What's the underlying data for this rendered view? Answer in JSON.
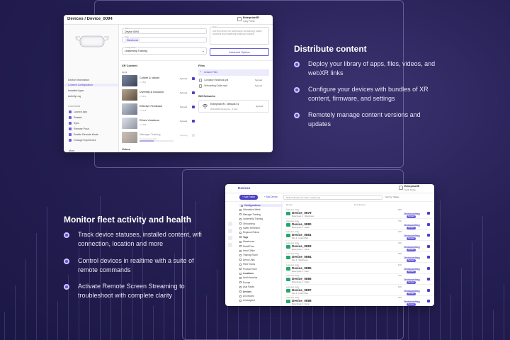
{
  "right_section": {
    "heading": "Distribute content",
    "bullets": [
      "Deploy your library of apps, files, videos, and webXR links",
      "Configure your devices with bundles of XR content, firmware, and settings",
      "Remotely manage content versions and updates"
    ]
  },
  "left_section": {
    "heading": "Monitor fleet activity and health",
    "bullets": [
      "Track device statuses, installed content, wifi connection, location and more",
      "Control devices in realtime with a suite of remote commands",
      "Activate Remote Screen Streaming to troubleshoot with complete clarity"
    ]
  },
  "device_panel": {
    "breadcrumb": "Devices / Device_0094",
    "org_name": "EnterpriseXR",
    "org_user": "Carly Fisher",
    "sidebar": [
      "Device Information",
      "Content Configuration",
      "Installed Apps",
      "Activity Log"
    ],
    "commands_title": "Commands",
    "commands": [
      "Launch App",
      "Restart",
      "Sync",
      "Remote Push",
      "Enable Remote Mode",
      "Change Experience"
    ],
    "more_label": "More",
    "fields": {
      "name_label": "Name",
      "name_value": "Device 0094",
      "tags_label": "Tags",
      "tag_value": "Warehouse",
      "config_label": "Configuration",
      "config_value": "Leadership Training",
      "description_label": "Notes",
      "description_placeholder": "Use this device for warehouse onboarding, safety sessions and leadership training modules.",
      "advanced_button": "Advanced Options"
    },
    "xr_content_title": "XR Content",
    "apps_header": "Apps",
    "apps": [
      {
        "name": "Culture & Values",
        "version": "v 4.5.0",
        "status": "Synced"
      },
      {
        "name": "Diversity & Inclusion",
        "version": "v 3.0.1",
        "status": "Synced"
      },
      {
        "name": "Effective Feedback",
        "version": "v 2.4.2",
        "status": "Synced"
      },
      {
        "name": "Ethics Violations",
        "version": "v 1.9.8",
        "status": "Synced"
      },
      {
        "name": "Manager Training",
        "version": "Downloading 42%",
        "status": "Syncing"
      }
    ],
    "apps_progress": 0.42,
    "videos_label": "Videos",
    "files_title": "Files",
    "files_selected": "Lesson Files",
    "files": [
      {
        "name": "Company Handbook.pdf",
        "status": "Synced"
      },
      {
        "name": "Onboarding Guide.mp4",
        "status": "Synced"
      }
    ],
    "wifi_title": "Wifi Networks",
    "wifi": {
      "name": "EnterpriseXR - Network 01",
      "detail": "WPA/WPA2 Enterprise · 5 GHz",
      "status": "Synced"
    }
  },
  "fleet_panel": {
    "title": "Devices",
    "org_name": "EnterpriseXR",
    "org_user": "Carly Fisher",
    "add_folder": "+ Add Folder",
    "add_device": "+ Add Device",
    "search_placeholder": "Search devices by name, serial, tag...",
    "toolbar_right": "Sort by: Status",
    "list_header": "Device",
    "list_count": "161 devices",
    "tree": [
      "Configurations",
      "Orientation Week",
      "Manager Training",
      "Leadership Training",
      "Onboarding",
      "Safety Refresher",
      "Regional Rollout",
      "Tags",
      "Warehouse",
      "Retail Floor",
      "Head Office",
      "Training Room",
      "Demo Units",
      "Field Teams",
      "Product Team",
      "Locations",
      "North America",
      "Europe",
      "Asia Pacific",
      "Devices",
      "All Devices",
      "Unassigned"
    ],
    "devices": [
      {
        "conn": "Last seen today",
        "name": "Device_0879",
        "sub": "Meta Quest 3 · Warehouse",
        "bat": "88%",
        "status": "Onboarding",
        "pill": "Synced"
      },
      {
        "conn": "Last seen today",
        "name": "Device_0880",
        "sub": "Meta Quest 3 · Retail",
        "bat": "75%",
        "status": "Onboarding",
        "pill": "Synced"
      },
      {
        "conn": "Last seen today",
        "name": "Device_0881",
        "sub": "Pico 4 · Head Office",
        "bat": "64%",
        "status": "Onboarding",
        "pill": "Synced"
      },
      {
        "conn": "Last seen today",
        "name": "Device_0883",
        "sub": "Meta Quest 3 · Demo",
        "bat": "92%",
        "status": "Onboarding",
        "pill": "Synced"
      },
      {
        "conn": "Last seen today",
        "name": "Device_0884",
        "sub": "Pico 4 · Warehouse",
        "bat": "58%",
        "status": "Onboarding",
        "pill": "Synced"
      },
      {
        "conn": "Last seen today",
        "name": "Device_0885",
        "sub": "Meta Quest 3 · Field",
        "bat": "81%",
        "status": "Onboarding",
        "pill": "Synced"
      },
      {
        "conn": "Last seen today",
        "name": "Device_0886",
        "sub": "Meta Quest 3 · Retail",
        "bat": "70%",
        "status": "Onboarding",
        "pill": "Synced"
      },
      {
        "conn": "Last seen today",
        "name": "Device_0887",
        "sub": "Pico 4 · Head Office",
        "bat": "66%",
        "status": "Onboarding",
        "pill": "Synced"
      },
      {
        "conn": "Last seen today",
        "name": "Device_0888",
        "sub": "Meta Quest 3 · Demo",
        "bat": "95%",
        "status": "Onboarding",
        "pill": "Synced"
      }
    ]
  },
  "colors": {
    "background": "#262055",
    "accent": "#4b3fc4",
    "online": "#22a86b"
  }
}
